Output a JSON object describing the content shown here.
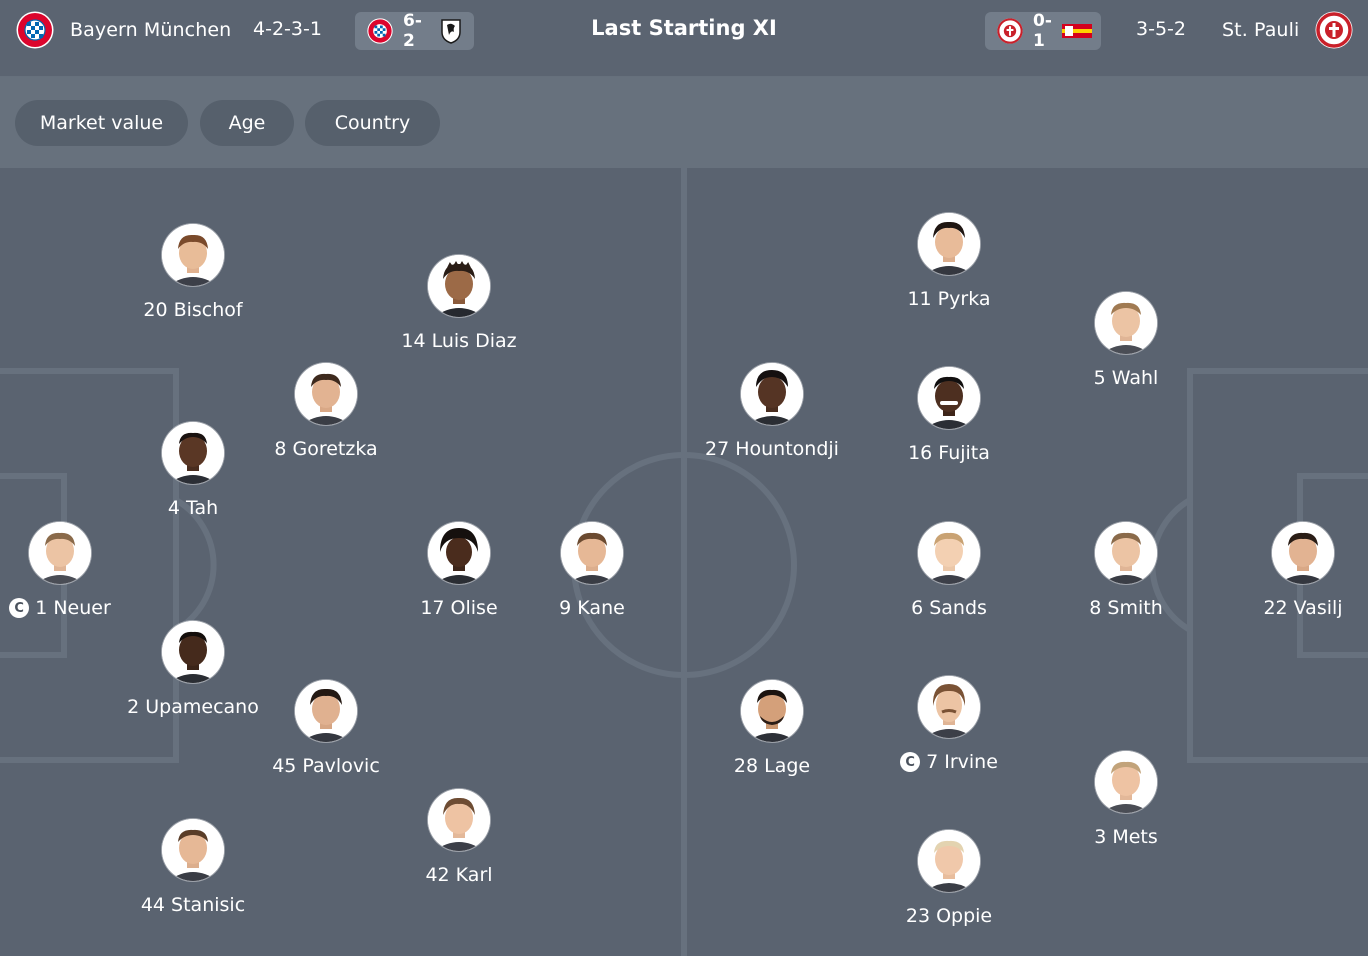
{
  "header": {
    "title": "Last Starting XI",
    "home": {
      "name": "Bayern München",
      "formation": "4-2-3-1",
      "crest_icon": "bayern-crest-icon",
      "last_result": {
        "score": "6-2",
        "opponent_icon": "freiburg-crest-icon"
      }
    },
    "away": {
      "name": "St. Pauli",
      "formation": "3-5-2",
      "crest_icon": "st-pauli-crest-icon",
      "last_result": {
        "score": "0-1",
        "opponent_icon": "union-berlin-crest-icon"
      }
    }
  },
  "filters": [
    "Market value",
    "Age",
    "Country"
  ],
  "captain_badge": "C",
  "home_players": [
    {
      "label": "20 Bischof"
    },
    {
      "label": "14 Luis Diaz"
    },
    {
      "label": "8 Goretzka"
    },
    {
      "label": "4 Tah"
    },
    {
      "label": "1 Neuer",
      "captain": true
    },
    {
      "label": "17 Olise"
    },
    {
      "label": "9 Kane"
    },
    {
      "label": "2 Upamecano"
    },
    {
      "label": "45 Pavlovic"
    },
    {
      "label": "44 Stanisic"
    },
    {
      "label": "42 Karl"
    }
  ],
  "away_players": [
    {
      "label": "11 Pyrka"
    },
    {
      "label": "5 Wahl"
    },
    {
      "label": "27 Hountondji"
    },
    {
      "label": "16 Fujita"
    },
    {
      "label": "6 Sands"
    },
    {
      "label": "8 Smith"
    },
    {
      "label": "22 Vasilj"
    },
    {
      "label": "28 Lage"
    },
    {
      "label": "7 Irvine",
      "captain": true
    },
    {
      "label": "3 Mets"
    },
    {
      "label": "23 Oppie"
    }
  ],
  "colors": {
    "header_bg": "#5b6471",
    "filter_bar_bg": "#67717d",
    "pill_bg": "#56606c",
    "pitch_bg": "#5a6370",
    "pitch_lines": "#67717e",
    "bayern_red": "#dc052d",
    "bayern_blue": "#0066b2",
    "st_pauli_red": "#c9202a",
    "union_red": "#d4011d",
    "union_yellow": "#ffd200"
  }
}
